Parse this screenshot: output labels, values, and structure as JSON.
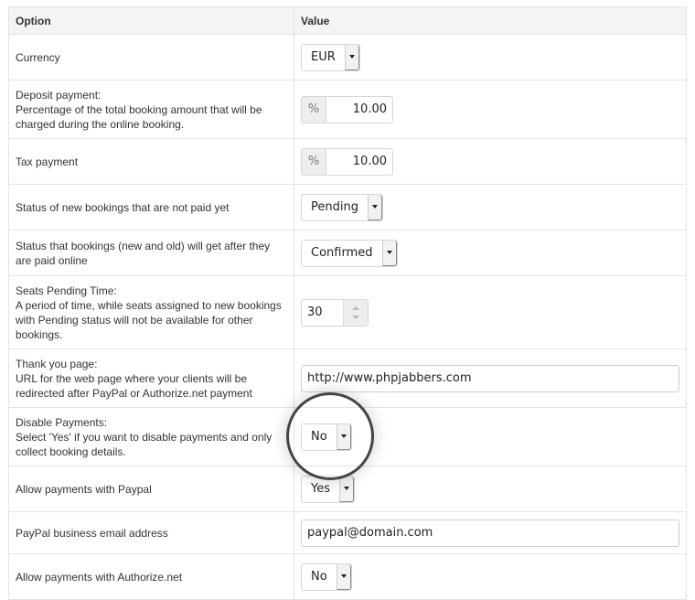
{
  "table": {
    "headers": {
      "option": "Option",
      "value": "Value"
    },
    "rows": [
      {
        "title": "Currency",
        "desc": "",
        "control": {
          "type": "select",
          "value": "EUR"
        }
      },
      {
        "title": "Deposit payment:",
        "desc": "Percentage of the total booking amount that will be charged during the online booking.",
        "control": {
          "type": "percent",
          "addon": "%",
          "value": "10.00"
        }
      },
      {
        "title": "Tax payment",
        "desc": "",
        "control": {
          "type": "percent",
          "addon": "%",
          "value": "10.00"
        }
      },
      {
        "title": "Status of new bookings that are not paid yet",
        "desc": "",
        "control": {
          "type": "select",
          "value": "Pending"
        }
      },
      {
        "title": "Status that bookings (new and old) will get after they are paid online",
        "desc": "",
        "control": {
          "type": "select",
          "value": "Confirmed"
        }
      },
      {
        "title": "Seats Pending Time:",
        "desc": "A period of time, while seats assigned to new bookings with Pending status will not be available for other bookings.",
        "control": {
          "type": "spinner",
          "value": "30"
        }
      },
      {
        "title": "Thank you page:",
        "desc": "URL for the web page where your clients will be redirected after PayPal or Authorize.net payment",
        "control": {
          "type": "text",
          "value": "http://www.phpjabbers.com"
        }
      },
      {
        "title": "Disable Payments:",
        "desc": "Select 'Yes' if you want to disable payments and only collect booking details.",
        "control": {
          "type": "select",
          "value": "No"
        }
      },
      {
        "title": "Allow payments with Paypal",
        "desc": "",
        "control": {
          "type": "select",
          "value": "Yes"
        }
      },
      {
        "title": "PayPal business email address",
        "desc": "",
        "control": {
          "type": "text",
          "value": "paypal@domain.com"
        }
      },
      {
        "title": "Allow payments with Authorize.net",
        "desc": "",
        "control": {
          "type": "select",
          "value": "No"
        }
      }
    ]
  }
}
